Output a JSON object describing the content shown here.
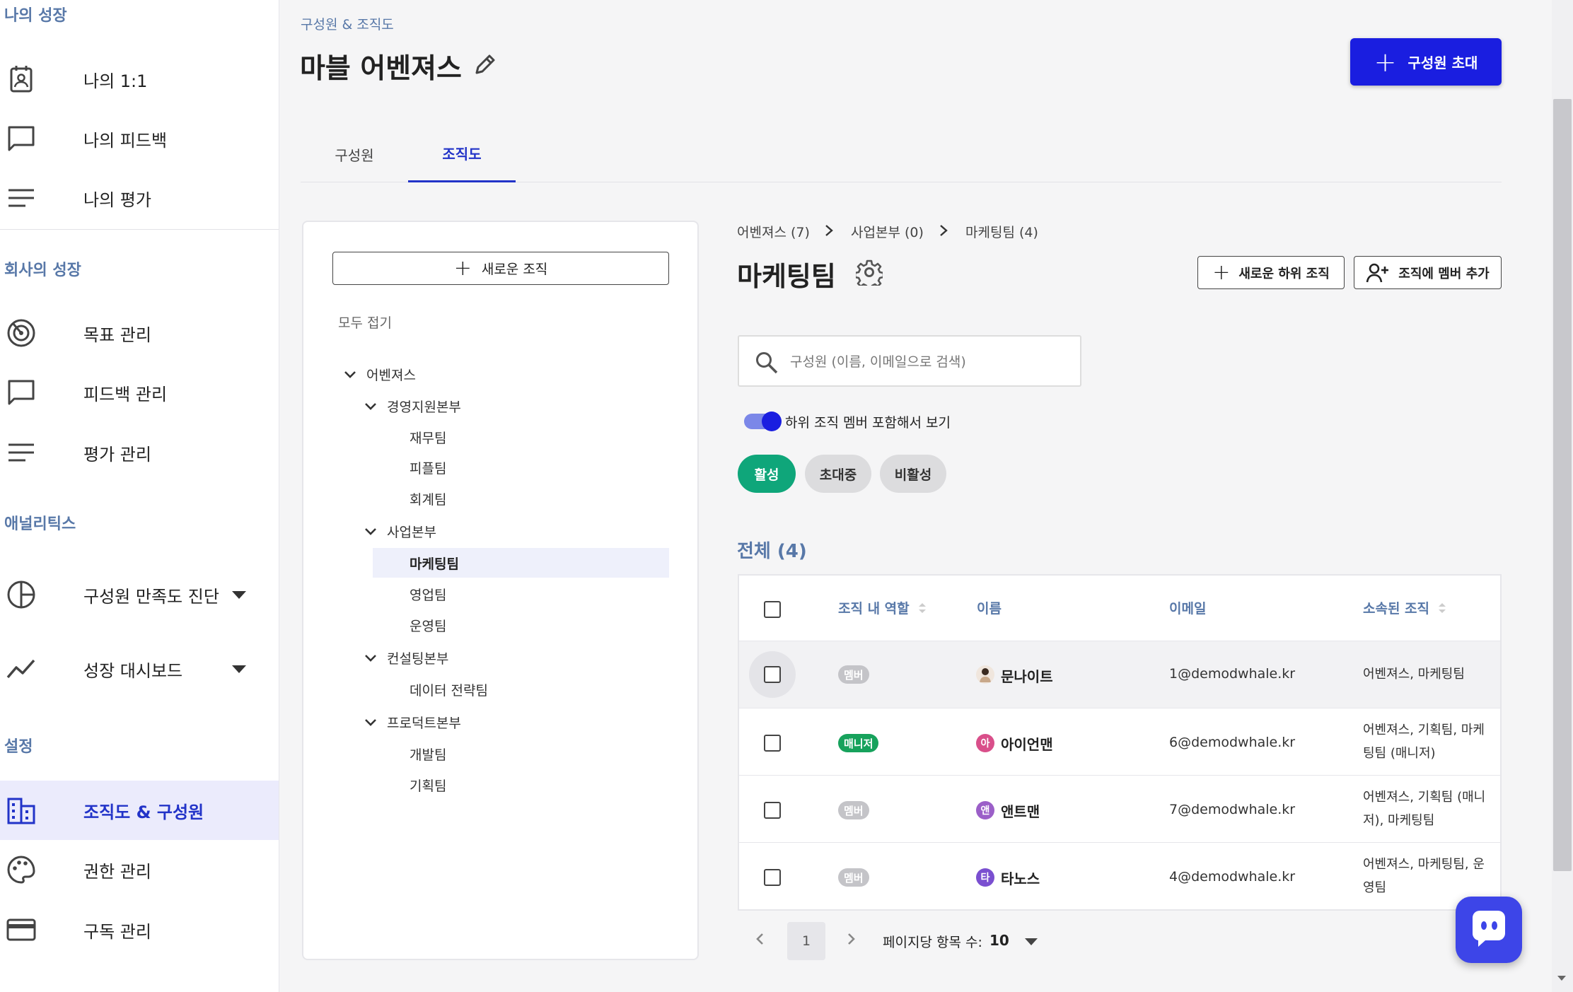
{
  "sidebar": {
    "sections": [
      {
        "title": "나의 성장",
        "items": [
          {
            "label": "나의 1:1",
            "icon": "contact-card-icon"
          },
          {
            "label": "나의 피드백",
            "icon": "chat-bubble-icon"
          },
          {
            "label": "나의 평가",
            "icon": "lines-icon"
          }
        ]
      },
      {
        "title": "회사의 성장",
        "items": [
          {
            "label": "목표 관리",
            "icon": "target-icon"
          },
          {
            "label": "피드백 관리",
            "icon": "chat-bubble-icon"
          },
          {
            "label": "평가 관리",
            "icon": "lines-icon"
          }
        ]
      },
      {
        "title": "애널리틱스",
        "items": [
          {
            "label": "구성원 만족도 진단",
            "icon": "pie-chart-icon"
          },
          {
            "label": "성장 대시보드",
            "icon": "trend-line-icon"
          }
        ]
      },
      {
        "title": "설정",
        "items": [
          {
            "label": "조직도 & 구성원",
            "icon": "building-icon",
            "active": true
          },
          {
            "label": "권한 관리",
            "icon": "palette-icon"
          },
          {
            "label": "구독 관리",
            "icon": "credit-card-icon"
          }
        ]
      }
    ]
  },
  "header": {
    "breadcrumb": "구성원 & 조직도",
    "title": "마블 어벤져스",
    "invite_label": "구성원 초대"
  },
  "tabs": [
    {
      "label": "구성원",
      "active": false
    },
    {
      "label": "조직도",
      "active": true
    }
  ],
  "tree": {
    "new_org_label": "새로운 조직",
    "collapse_all_label": "모두 접기",
    "nodes": [
      {
        "label": "어벤져스",
        "expanded": true
      },
      {
        "label": "경영지원본부",
        "expanded": true
      },
      {
        "label": "재무팀"
      },
      {
        "label": "피플팀"
      },
      {
        "label": "회계팀"
      },
      {
        "label": "사업본부",
        "expanded": true
      },
      {
        "label": "마케팅팀",
        "selected": true
      },
      {
        "label": "영업팀"
      },
      {
        "label": "운영팀"
      },
      {
        "label": "컨설팅본부",
        "expanded": true
      },
      {
        "label": "데이터 전략팀"
      },
      {
        "label": "프로덕트본부",
        "expanded": true
      },
      {
        "label": "개발팀"
      },
      {
        "label": "기획팀"
      }
    ]
  },
  "detail": {
    "breadcrumbs": [
      "어벤져스 (7)",
      "사업본부 (0)",
      "마케팅팀 (4)"
    ],
    "team_title": "마케팅팀",
    "new_sub_org_label": "새로운 하위 조직",
    "add_member_label": "조직에 멤버 추가",
    "search_placeholder": "구성원 (이름, 이메일으로 검색)",
    "include_sub_label": "하위 조직 멤버 포함해서 보기",
    "include_sub_on": true,
    "filters": [
      {
        "label": "활성",
        "active": true
      },
      {
        "label": "초대중",
        "active": false
      },
      {
        "label": "비활성",
        "active": false
      }
    ],
    "total_label": "전체 (4)"
  },
  "table": {
    "columns": [
      "조직 내 역할",
      "이름",
      "이메일",
      "소속된 조직"
    ],
    "rows": [
      {
        "role": "멤버",
        "name": "문나이트",
        "avatar": "",
        "email": "1@demodwhale.kr",
        "orgs": "어벤져스, 마케팅팀"
      },
      {
        "role": "매니저",
        "name": "아이언맨",
        "avatar": "아",
        "email": "6@demodwhale.kr",
        "orgs": "어벤져스, 기획팀, 마케팅팀 (매니저)"
      },
      {
        "role": "멤버",
        "name": "앤트맨",
        "avatar": "앤",
        "email": "7@demodwhale.kr",
        "orgs": "어벤져스, 기획팀 (매니저), 마케팅팀"
      },
      {
        "role": "멤버",
        "name": "타노스",
        "avatar": "타",
        "email": "4@demodwhale.kr",
        "orgs": "어벤져스, 마케팅팀, 운영팀"
      }
    ]
  },
  "pagination": {
    "current_page": "1",
    "per_page_label": "페이지당 항목 수:",
    "per_page_value": "10"
  },
  "colors": {
    "accent": "#1a1ee0",
    "active_chip": "#0fa67a",
    "manager_badge": "#17a25c",
    "section_title": "#5878a8"
  }
}
